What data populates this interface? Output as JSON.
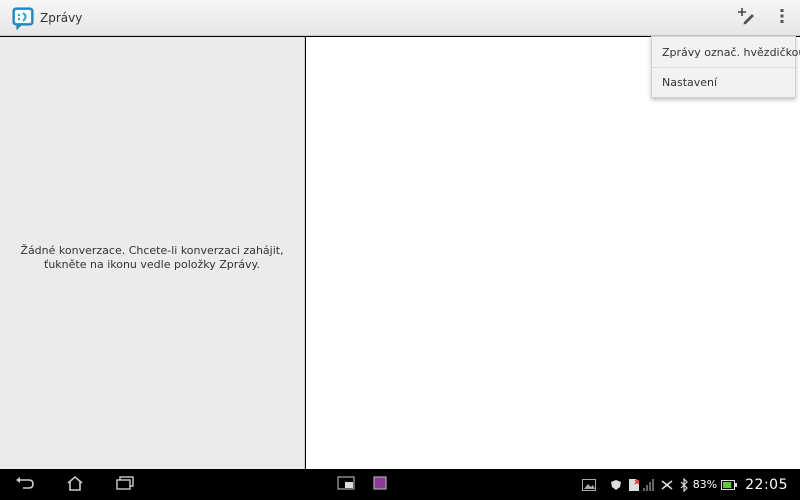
{
  "app": {
    "title": "Zprávy"
  },
  "icons": {
    "app": "messaging-app-icon",
    "compose": "new-message-icon",
    "overflow": "overflow-menu-icon",
    "back": "back-icon",
    "home": "home-icon",
    "recents": "recent-apps-icon"
  },
  "conversations": {
    "empty_message": "Žádné konverzace. Chcete-li konverzaci zahájit, ťukněte na ikonu vedle položky Zprávy."
  },
  "overflow_menu": {
    "items": [
      {
        "label": "Zprávy označ. hvězdičkou"
      },
      {
        "label": "Nastavení"
      }
    ]
  },
  "status_bar": {
    "battery_percent": "83%",
    "time": "22:05"
  },
  "colors": {
    "accent": "#1a8ec9",
    "battery": "#5fc93a",
    "clip_accent": "#8c3a96"
  }
}
